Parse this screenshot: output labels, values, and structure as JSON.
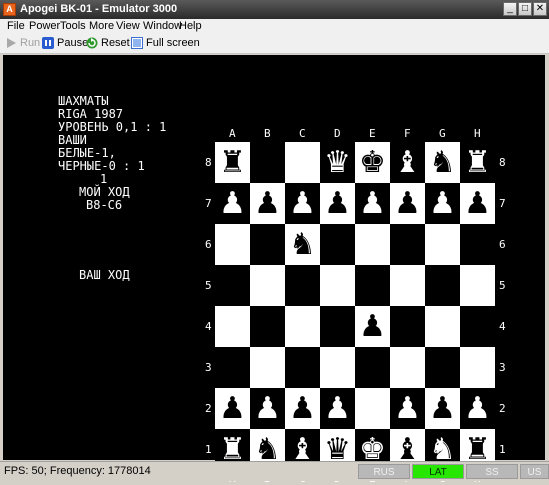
{
  "window": {
    "title": "Apogei BK-01 - Emulator 3000",
    "app_icon_glyph": "A",
    "min_glyph": "_",
    "max_glyph": "□",
    "close_glyph": "✕"
  },
  "menu": {
    "items": [
      "File",
      "Power",
      "Tools",
      "More",
      "View",
      "Window",
      "Help"
    ]
  },
  "toolbar": {
    "run_label": "Run",
    "pause_label": "Pause",
    "reset_label": "Reset",
    "fullscreen_label": "Full screen"
  },
  "screen": {
    "lines": {
      "l1": "ШАХМАТЫ",
      "l2": "RIGA 1987",
      "l3": "УРОВЕНЬ 0,1 : 1",
      "l4": "ВАШИ",
      "l5": "БЕЛЫЕ-1,",
      "l6": "ЧЕРНЫЕ-0 : 1",
      "l7": "1",
      "l8": "МОЙ ХОД",
      "l9": "B8-C6",
      "l10": "ВАШ ХОД"
    },
    "files": [
      "A",
      "B",
      "C",
      "D",
      "E",
      "F",
      "G",
      "H"
    ],
    "ranks": [
      "8",
      "7",
      "6",
      "5",
      "4",
      "3",
      "2",
      "1"
    ],
    "board": [
      [
        "r",
        "",
        "",
        "q",
        "k",
        "b",
        "n",
        "r"
      ],
      [
        "p",
        "p",
        "p",
        "p",
        "p",
        "p",
        "p",
        "p"
      ],
      [
        "",
        "",
        "n",
        "",
        "",
        "",
        "",
        ""
      ],
      [
        "",
        "",
        "",
        "",
        "",
        "",
        "",
        ""
      ],
      [
        "",
        "",
        "",
        "",
        "P",
        "",
        "",
        ""
      ],
      [
        "",
        "",
        "",
        "",
        "",
        "",
        "",
        ""
      ],
      [
        "P",
        "P",
        "P",
        "P",
        "",
        "P",
        "P",
        "P"
      ],
      [
        "R",
        "N",
        "B",
        "Q",
        "K",
        "B",
        "N",
        "R"
      ]
    ],
    "piece_glyphs": {
      "r": "♜",
      "n": "♞",
      "b": "♝",
      "q": "♛",
      "k": "♚",
      "p": "♟",
      "R": "♜",
      "N": "♞",
      "B": "♝",
      "Q": "♛",
      "K": "♚",
      "P": "♟"
    }
  },
  "status": {
    "text": "FPS: 50; Frequency: 1778014",
    "indicators": [
      {
        "label": "RUS",
        "active": false
      },
      {
        "label": "LAT",
        "active": true
      },
      {
        "label": "SS",
        "active": false
      },
      {
        "label": "US",
        "active": false
      }
    ]
  },
  "colors": {
    "lat_active": "#27e600",
    "screen_bg": "#000000",
    "screen_fg": "#ffffff"
  }
}
